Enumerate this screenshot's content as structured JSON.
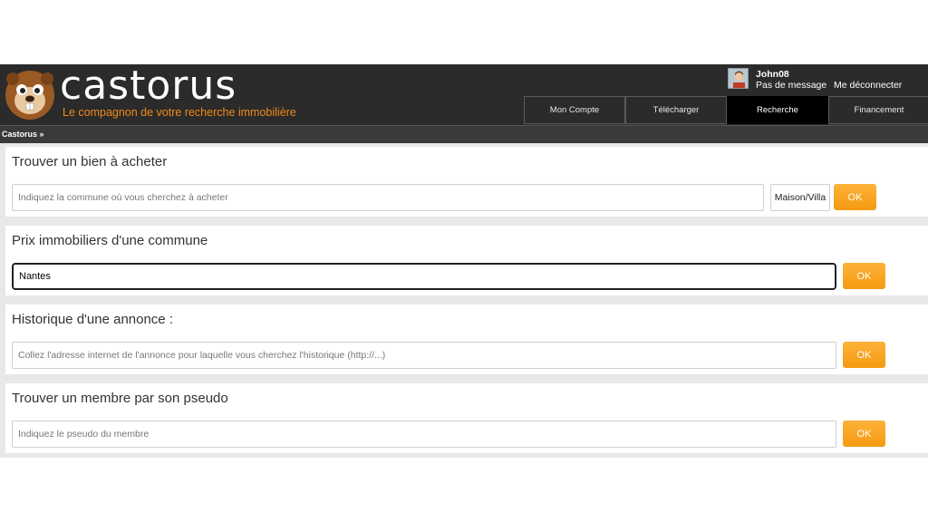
{
  "brand": {
    "name": "castorus",
    "tagline": "Le compagnon de votre recherche immobilière"
  },
  "user": {
    "name": "John08",
    "messages": "Pas de message",
    "logout": "Me déconnecter"
  },
  "tabs": [
    {
      "label": "Mon Compte"
    },
    {
      "label": "Télécharger"
    },
    {
      "label": "Recherche"
    },
    {
      "label": "Financement"
    }
  ],
  "breadcrumb": "Castorus »",
  "sections": {
    "buy": {
      "title": "Trouver un bien à acheter",
      "placeholder": "Indiquez la commune où vous cherchez à acheter",
      "select_value": "Maison/Villa",
      "button": "OK"
    },
    "prices": {
      "title": "Prix immobiliers d'une commune",
      "value": "Nantes",
      "button": "OK"
    },
    "history": {
      "title": "Historique d'une annonce :",
      "placeholder": "Collez l'adresse internet de l'annonce pour laquelle vous cherchez l'historique (http://...)",
      "button": "OK"
    },
    "member": {
      "title": "Trouver un membre par son pseudo",
      "placeholder": "Indiquez le pseudo du membre",
      "button": "OK"
    }
  },
  "colors": {
    "header": "#2b2b2b",
    "accent": "#f28a1a",
    "button": "#f8a21f"
  }
}
